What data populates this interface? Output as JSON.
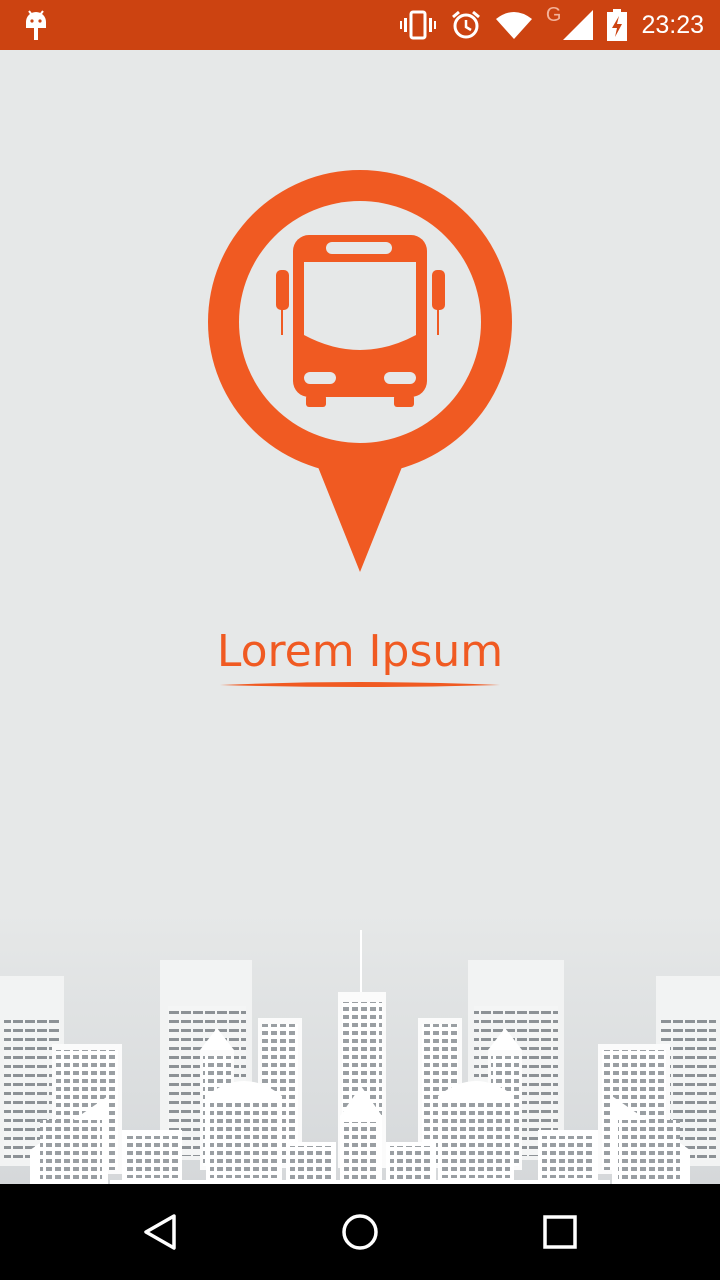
{
  "status_bar": {
    "time": "23:23",
    "network_label": "G",
    "icons": [
      "android-debug-icon",
      "vibrate-icon",
      "alarm-icon",
      "wifi-icon",
      "cell-signal-icon",
      "battery-charging-icon"
    ]
  },
  "brand": {
    "name": "Lorem Ipsum",
    "logo_icon": "bus-location-pin-icon",
    "accent_color": "#f05a22"
  },
  "background": {
    "illustration": "city-skyline-illustration"
  },
  "nav_bar": {
    "buttons": [
      "back-icon",
      "home-icon",
      "recents-icon"
    ]
  }
}
